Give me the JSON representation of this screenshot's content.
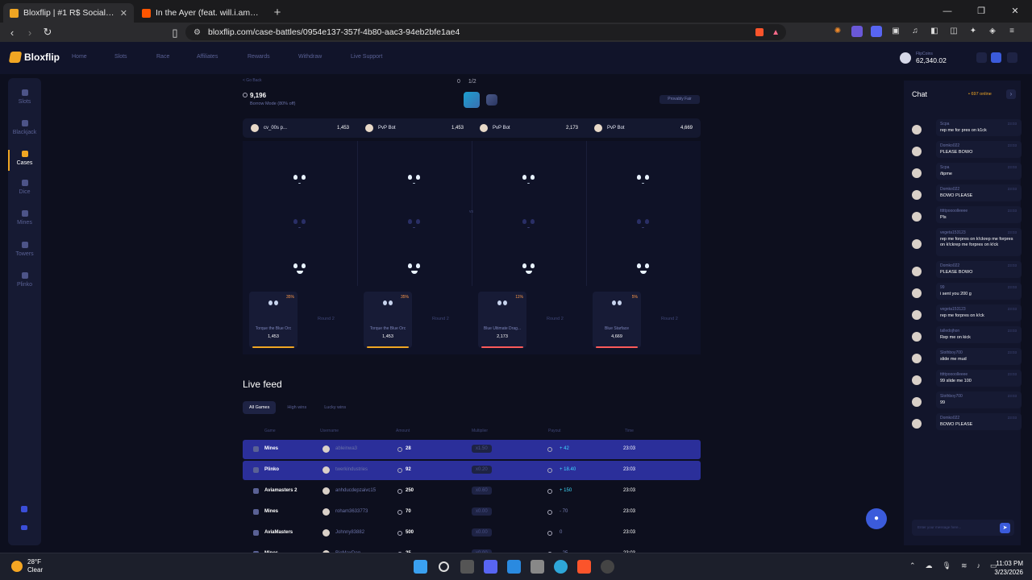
{
  "browser": {
    "tabs": [
      {
        "title": "Bloxflip | #1 R$ Social Casino",
        "active": true
      },
      {
        "title": "In the Ayer (feat. will.i.am) by Flo",
        "active": false
      }
    ],
    "url": "bloxflip.com/case-battles/0954e137-357f-4b80-aac3-94eb2bfe1ae4"
  },
  "site": {
    "logo": "Bloxflip",
    "nav": [
      "Home",
      "Slots",
      "Race",
      "Affiliates",
      "Rewards",
      "Withdraw",
      "Live Support"
    ],
    "balance_label": "FlipCoins",
    "balance": "62,340.02"
  },
  "sidebar": {
    "items": [
      "Slots",
      "Blackjack",
      "Cases",
      "Dice",
      "Mines",
      "Towers",
      "Plinko"
    ],
    "active": "Cases"
  },
  "battle": {
    "go_back": "< Go Back",
    "cost": "9,196",
    "mode": "Borrow Mode (80% off)",
    "round_count": "0",
    "round_total": "1/2",
    "provably_fair": "Provably Fair",
    "players": [
      {
        "name": "cv_00s p...",
        "value": "1,453"
      },
      {
        "name": "PvP Bot",
        "value": "1,453"
      },
      {
        "name": "PvP Bot",
        "value": "2,173"
      },
      {
        "name": "PvP Bot",
        "value": "4,669"
      }
    ],
    "vs_label": "vs",
    "prizes": [
      {
        "name": "Torque the Blue Orc",
        "value": "1,453",
        "pct": "35%",
        "bar": "#f0a623"
      },
      {
        "name": "Torque the Blue Orc",
        "value": "1,453",
        "pct": "35%",
        "bar": "#f0a623"
      },
      {
        "name": "Blue Ultimate Drag...",
        "value": "2,173",
        "pct": "11%",
        "bar": "#ff5a5a"
      },
      {
        "name": "Blue Starface",
        "value": "4,669",
        "pct": "5%",
        "bar": "#ff5a5a"
      }
    ],
    "round2_label": "Round 2"
  },
  "live_feed": {
    "title": "Live feed",
    "filters": [
      "All Games",
      "High wins",
      "Lucky wins"
    ],
    "columns": [
      "Game",
      "Username",
      "Amount",
      "Multiplier",
      "Payout",
      "Time"
    ],
    "rows": [
      {
        "game": "Mines",
        "user": "ableinwa3",
        "amount": "28",
        "mult": "x1.50",
        "payout": "+ 42",
        "time": "23:03",
        "hl": true,
        "win": true
      },
      {
        "game": "Plinko",
        "user": "twerkindustries",
        "amount": "92",
        "mult": "x0.20",
        "payout": "+ 18.40",
        "time": "23:03",
        "hl": true,
        "win": true
      },
      {
        "game": "Aviamasters 2",
        "user": "anhducdepzaivc15",
        "amount": "250",
        "mult": "x0.60",
        "payout": "+ 150",
        "time": "23:03",
        "hl": false,
        "win": true
      },
      {
        "game": "Mines",
        "user": "roham3633773",
        "amount": "70",
        "mult": "x0.00",
        "payout": "- 70",
        "time": "23:03",
        "hl": false,
        "win": false
      },
      {
        "game": "AviaMasters",
        "user": "Johnny83882",
        "amount": "500",
        "mult": "x0.00",
        "payout": "0",
        "time": "23:03",
        "hl": false,
        "win": false
      },
      {
        "game": "Mines",
        "user": "BigMaxDog",
        "amount": "25",
        "mult": "x0.00",
        "payout": "- 25",
        "time": "23:03",
        "hl": false,
        "win": false
      }
    ]
  },
  "chat": {
    "title": "Chat",
    "online": "• 697 online",
    "messages": [
      {
        "name": "Scpa",
        "time": "23:03",
        "text": "rep me for pres on k1ck"
      },
      {
        "name": "Domko022",
        "time": "23:03",
        "text": "PLEASE BOWO"
      },
      {
        "name": "Scpa",
        "time": "23:03",
        "text": "/tipme"
      },
      {
        "name": "Domko022",
        "time": "23:03",
        "text": "BOWO PLEASE"
      },
      {
        "name": "tttttpoooolleeee",
        "time": "23:03",
        "text": "Pls"
      },
      {
        "name": "vegeta153123",
        "time": "23:03",
        "text": "rep me forpres on k!ckrep me forpres on k!ckrep me forpres on k!ck"
      },
      {
        "name": "Domko022",
        "time": "23:03",
        "text": "PLEASE BOWO"
      },
      {
        "name": "99",
        "time": "23:03",
        "text": "i sent you 200 g"
      },
      {
        "name": "vegeta153123",
        "time": "23:03",
        "text": "rep me forpres on k!ck"
      },
      {
        "name": "talledojhon",
        "time": "23:03",
        "text": "Rep me on kick"
      },
      {
        "name": "Slothboy700",
        "time": "23:03",
        "text": "slide me mud"
      },
      {
        "name": "tttttpoooolleeee",
        "time": "23:03",
        "text": "99 slide me 100"
      },
      {
        "name": "Slothboy700",
        "time": "23:03",
        "text": "99"
      },
      {
        "name": "Domko022",
        "time": "23:03",
        "text": "BOWO PLEASE"
      }
    ],
    "input_placeholder": "Enter your message here..."
  },
  "taskbar": {
    "temp": "28°F",
    "weather": "Clear",
    "time": "11:03 PM",
    "date": "3/23/2026"
  }
}
